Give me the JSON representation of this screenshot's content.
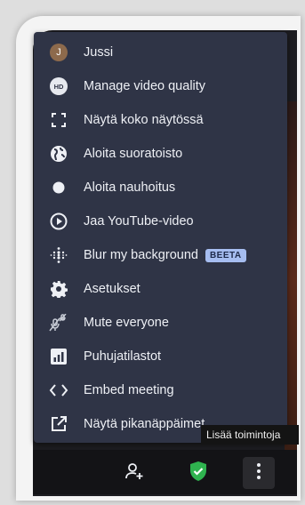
{
  "menu": {
    "items": [
      {
        "label": "Jussi",
        "icon": "avatar",
        "initial": "J"
      },
      {
        "label": "Manage video quality",
        "icon": "hd-icon",
        "icon_text": "HD"
      },
      {
        "label": "Näytä koko näytössä",
        "icon": "fullscreen-icon"
      },
      {
        "label": "Aloita suoratoisto",
        "icon": "globe-icon"
      },
      {
        "label": "Aloita nauhoitus",
        "icon": "record-icon"
      },
      {
        "label": "Jaa YouTube-video",
        "icon": "play-circle-icon"
      },
      {
        "label": "Blur my background",
        "icon": "blur-icon",
        "badge": "BEETA"
      },
      {
        "label": "Asetukset",
        "icon": "gear-icon"
      },
      {
        "label": "Mute everyone",
        "icon": "mute-everyone-icon"
      },
      {
        "label": "Puhujatilastot",
        "icon": "stats-icon"
      },
      {
        "label": "Embed meeting",
        "icon": "code-icon"
      },
      {
        "label": "Näytä pikanäppäimet",
        "icon": "external-link-icon"
      }
    ]
  },
  "tooltip": {
    "text": "Lisää toimintoja"
  },
  "toolbar": {
    "buttons": [
      "invite-people-icon",
      "security-shield-icon",
      "more-actions-icon"
    ]
  },
  "colors": {
    "menu_bg": "#2f3446",
    "text": "#eef0f5",
    "badge_bg": "#a6bdf0",
    "shield_green": "#2fb34f"
  }
}
